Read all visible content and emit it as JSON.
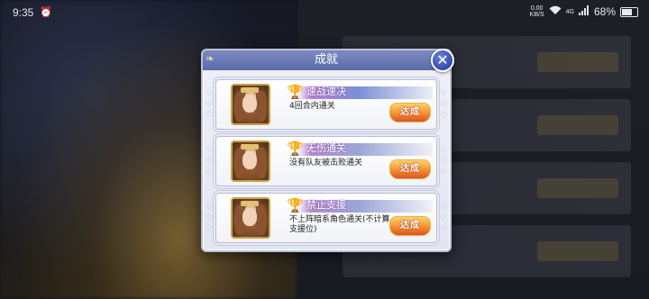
{
  "status_bar": {
    "time": "9:35",
    "alarm_icon": "alarm-clock-icon",
    "net_speed_value": "0.00",
    "net_speed_unit": "KB/S",
    "signal": "4G",
    "battery": "68%"
  },
  "dialog": {
    "title": "成就",
    "close_icon": "close-icon"
  },
  "achievements": [
    {
      "name": "速战速决",
      "description": "4回合内通关",
      "stamp": "达成",
      "highlight": true
    },
    {
      "name": "无伤通关",
      "description": "没有队友被击败通关",
      "stamp": "达成",
      "highlight": false
    },
    {
      "name": "禁止支援",
      "description": "不上阵暗系角色通关(不计算支援位)",
      "stamp": "达成",
      "highlight": false
    }
  ],
  "colors": {
    "header": "#5b6aa9",
    "close_button": "#2f4aa8",
    "stamp": "#f28a2b",
    "trophy": "#b68b2e"
  }
}
